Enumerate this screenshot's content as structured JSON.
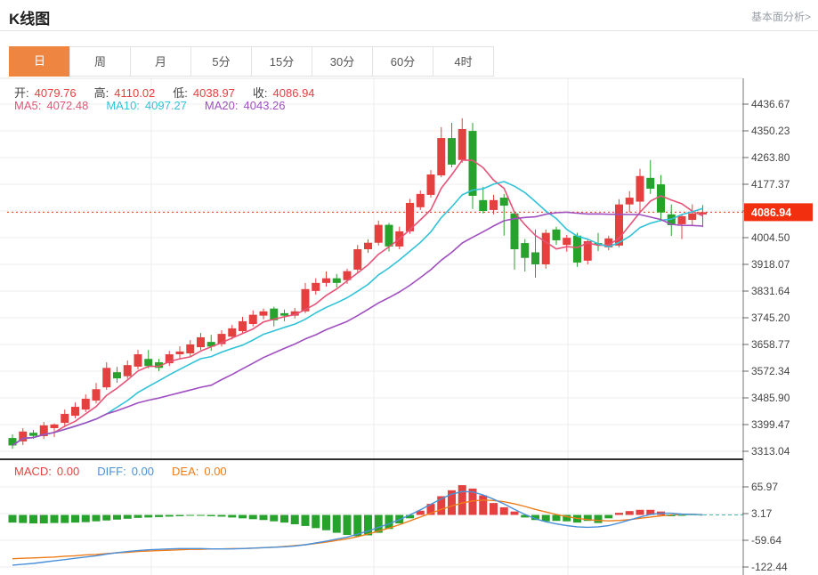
{
  "header": {
    "title": "K线图",
    "link": "基本面分析>"
  },
  "tabs": {
    "items": [
      {
        "label": "日",
        "name": "tab-day",
        "active": true
      },
      {
        "label": "周",
        "name": "tab-week",
        "active": false
      },
      {
        "label": "月",
        "name": "tab-month",
        "active": false
      },
      {
        "label": "5分",
        "name": "tab-5min",
        "active": false
      },
      {
        "label": "15分",
        "name": "tab-15min",
        "active": false
      },
      {
        "label": "30分",
        "name": "tab-30min",
        "active": false
      },
      {
        "label": "60分",
        "name": "tab-60min",
        "active": false
      },
      {
        "label": "4时",
        "name": "tab-4hour",
        "active": false
      }
    ]
  },
  "colors": {
    "up": "#e54040",
    "down": "#27a22d",
    "ma5": "#e65377",
    "ma10": "#30c3d8",
    "ma20": "#a04fc0",
    "diff": "#4a90d9",
    "dea": "#ee7c1b",
    "macd_label": "#e54040",
    "price_badge": "#f22f0f",
    "price_line": "#f22f0f",
    "tab_active": "#ee8540",
    "ohlc_label": "#444444",
    "axis_text": "#444444",
    "grid": "#ededed",
    "flat_dash": "#4db6ac"
  },
  "overlays": {
    "ohlc": [
      {
        "label": "开:",
        "value": "4079.76",
        "color_key": "up"
      },
      {
        "label": "高:",
        "value": "4110.02",
        "color_key": "up"
      },
      {
        "label": "低:",
        "value": "4038.97",
        "color_key": "up"
      },
      {
        "label": "收:",
        "value": "4086.94",
        "color_key": "up"
      }
    ],
    "ma": [
      {
        "label": "MA5:",
        "value": "4072.48",
        "color_key": "ma5"
      },
      {
        "label": "MA10:",
        "value": "4097.27",
        "color_key": "ma10"
      },
      {
        "label": "MA20:",
        "value": "4043.26",
        "color_key": "ma20"
      }
    ],
    "macd": [
      {
        "label": "MACD:",
        "value": "0.00",
        "color_key": "macd_label"
      },
      {
        "label": "DIFF:",
        "value": "0.00",
        "color_key": "diff"
      },
      {
        "label": "DEA:",
        "value": "0.00",
        "color_key": "dea"
      }
    ]
  },
  "chart_data": {
    "type": "candlestick+macd",
    "period": "日",
    "current_price": 4086.94,
    "current_price_label": "4086.94",
    "price_axis": {
      "top_value": 4436.67,
      "step_value": 86.433,
      "tick_labels": [
        "4436.67",
        "4350.23",
        "4263.80",
        "4177.37",
        "",
        "4004.50",
        "3918.07",
        "3831.64",
        "3745.20",
        "3658.77",
        "3572.34",
        "3485.90",
        "3399.47",
        "3313.04"
      ]
    },
    "macd_axis": {
      "top_value": 65.97,
      "step_value": 62.8,
      "tick_labels": [
        "65.97",
        "3.17",
        "-59.64",
        "-122.44"
      ]
    },
    "ma_windows": [
      5,
      10,
      20
    ],
    "candles_ohlc": [
      [
        3356,
        3368,
        3321,
        3332
      ],
      [
        3345,
        3388,
        3333,
        3377
      ],
      [
        3373,
        3382,
        3353,
        3363
      ],
      [
        3362,
        3408,
        3353,
        3397
      ],
      [
        3388,
        3403,
        3359,
        3400
      ],
      [
        3405,
        3448,
        3391,
        3434
      ],
      [
        3428,
        3471,
        3420,
        3457
      ],
      [
        3448,
        3497,
        3440,
        3483
      ],
      [
        3477,
        3534,
        3468,
        3514
      ],
      [
        3520,
        3601,
        3512,
        3583
      ],
      [
        3569,
        3586,
        3535,
        3549
      ],
      [
        3556,
        3607,
        3548,
        3592
      ],
      [
        3587,
        3641,
        3578,
        3627
      ],
      [
        3612,
        3641,
        3581,
        3589
      ],
      [
        3601,
        3612,
        3572,
        3583
      ],
      [
        3598,
        3638,
        3589,
        3627
      ],
      [
        3627,
        3653,
        3610,
        3636
      ],
      [
        3630,
        3673,
        3621,
        3659
      ],
      [
        3650,
        3696,
        3641,
        3682
      ],
      [
        3667,
        3690,
        3638,
        3652
      ],
      [
        3660,
        3705,
        3652,
        3693
      ],
      [
        3684,
        3722,
        3675,
        3711
      ],
      [
        3702,
        3748,
        3693,
        3734
      ],
      [
        3725,
        3769,
        3717,
        3755
      ],
      [
        3752,
        3775,
        3740,
        3766
      ],
      [
        3775,
        3781,
        3717,
        3737
      ],
      [
        3760,
        3772,
        3734,
        3752
      ],
      [
        3752,
        3777,
        3743,
        3766
      ],
      [
        3766,
        3858,
        3760,
        3838
      ],
      [
        3832,
        3873,
        3820,
        3858
      ],
      [
        3858,
        3895,
        3846,
        3873
      ],
      [
        3873,
        3887,
        3843,
        3858
      ],
      [
        3867,
        3904,
        3855,
        3896
      ],
      [
        3901,
        3981,
        3893,
        3967
      ],
      [
        3967,
        3999,
        3955,
        3988
      ],
      [
        3988,
        4060,
        3979,
        4046
      ],
      [
        4046,
        4052,
        3960,
        3976
      ],
      [
        3976,
        4040,
        3967,
        4025
      ],
      [
        4025,
        4130,
        4017,
        4117
      ],
      [
        4103,
        4157,
        4094,
        4146
      ],
      [
        4143,
        4223,
        4134,
        4209
      ],
      [
        4206,
        4362,
        4200,
        4327
      ],
      [
        4327,
        4376,
        4232,
        4241
      ],
      [
        4256,
        4391,
        4247,
        4356
      ],
      [
        4350,
        4376,
        4097,
        4140
      ],
      [
        4126,
        4169,
        4083,
        4091
      ],
      [
        4094,
        4143,
        4080,
        4126
      ],
      [
        4134,
        4146,
        4011,
        4108
      ],
      [
        4083,
        4091,
        3901,
        3967
      ],
      [
        3987,
        4000,
        3895,
        3939
      ],
      [
        3957,
        4031,
        3875,
        3918
      ],
      [
        3918,
        4031,
        3904,
        4020
      ],
      [
        4031,
        4040,
        3981,
        3996
      ],
      [
        3981,
        4013,
        3959,
        4004
      ],
      [
        4011,
        4020,
        3910,
        3924
      ],
      [
        3930,
        3999,
        3918,
        3993
      ],
      [
        3987,
        4020,
        3961,
        3981
      ],
      [
        3973,
        4011,
        3964,
        4002
      ],
      [
        3979,
        4129,
        3973,
        4112
      ],
      [
        4112,
        4155,
        4086,
        4134
      ],
      [
        4121,
        4227,
        4088,
        4204
      ],
      [
        4198,
        4256,
        4146,
        4163
      ],
      [
        4177,
        4207,
        4057,
        4086
      ],
      [
        4080,
        4112,
        4010,
        4045
      ],
      [
        4048,
        4080,
        4000,
        4074
      ],
      [
        4062,
        4112,
        4045,
        4083
      ],
      [
        4079.76,
        4110.02,
        4038.97,
        4086.94
      ]
    ],
    "macd": {
      "bars": [
        -18,
        -19,
        -20,
        -20,
        -19,
        -19,
        -18,
        -17,
        -15,
        -13,
        -11,
        -9,
        -7,
        -6,
        -5,
        -4,
        -3,
        -2,
        -2,
        -3,
        -4,
        -6,
        -8,
        -10,
        -12,
        -15,
        -18,
        -22,
        -26,
        -31,
        -36,
        -42,
        -47,
        -50,
        -48,
        -42,
        -33,
        -20,
        -8,
        10,
        26,
        44,
        58,
        70,
        62,
        46,
        28,
        18,
        8,
        -6,
        -12,
        -15,
        -14,
        -15,
        -18,
        -14,
        -19,
        -8,
        5,
        9,
        12,
        12,
        8,
        -3,
        -2,
        0,
        0
      ],
      "dif": [
        -118,
        -116,
        -114,
        -111,
        -108,
        -105,
        -102,
        -99,
        -96,
        -92,
        -89,
        -86,
        -84,
        -82,
        -81,
        -80,
        -79,
        -79,
        -79,
        -80,
        -80,
        -80,
        -79,
        -78,
        -77,
        -76,
        -75,
        -73,
        -70,
        -66,
        -62,
        -57,
        -52,
        -45,
        -38,
        -29,
        -21,
        -11,
        0,
        12,
        25,
        38,
        49,
        55,
        54,
        47,
        37,
        26,
        13,
        1,
        -9,
        -16,
        -21,
        -25,
        -28,
        -29,
        -28,
        -25,
        -19,
        -12,
        -5,
        1,
        4,
        4,
        2,
        1,
        0
      ],
      "dea": [
        -103,
        -102,
        -101,
        -100,
        -99,
        -97,
        -96,
        -94,
        -93,
        -91,
        -89,
        -88,
        -86,
        -85,
        -84,
        -83,
        -82,
        -81,
        -81,
        -80,
        -80,
        -79,
        -79,
        -78,
        -77,
        -76,
        -74,
        -72,
        -70,
        -67,
        -64,
        -60,
        -56,
        -51,
        -45,
        -38,
        -31,
        -23,
        -14,
        -5,
        4,
        13,
        21,
        28,
        33,
        35,
        34,
        31,
        26,
        20,
        13,
        7,
        1,
        -4,
        -8,
        -11,
        -13,
        -14,
        -13,
        -11,
        -8,
        -5,
        -2,
        0,
        1,
        1,
        0
      ]
    },
    "legend": {
      "macd_final": "0.00",
      "diff_final": "0.00",
      "dea_final": "0.00"
    }
  }
}
